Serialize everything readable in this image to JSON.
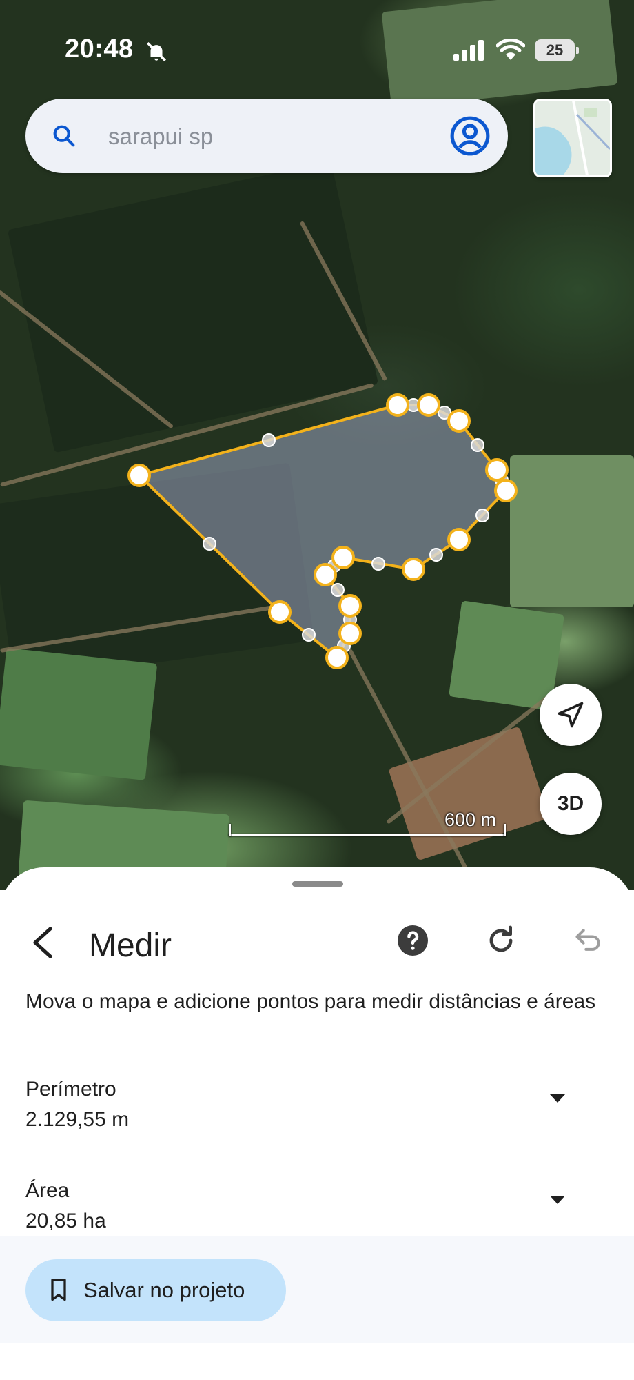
{
  "status_bar": {
    "time": "20:48",
    "battery": "25"
  },
  "search": {
    "text": "sarapui sp"
  },
  "map": {
    "scale_label": "600 m",
    "btn_3d": "3D"
  },
  "sheet": {
    "title": "Medir",
    "instructions": "Mova o mapa e adicione pontos para medir distâncias e áreas",
    "perimeter": {
      "label": "Perímetro",
      "value": "2.129,55 m"
    },
    "area": {
      "label": "Área",
      "value": "20,85 ha"
    },
    "save_label": "Salvar no projeto"
  },
  "colors": {
    "accent": "#0b57d0",
    "polygon_stroke": "#f3b21b",
    "save_button_bg": "#c3e3fb"
  }
}
